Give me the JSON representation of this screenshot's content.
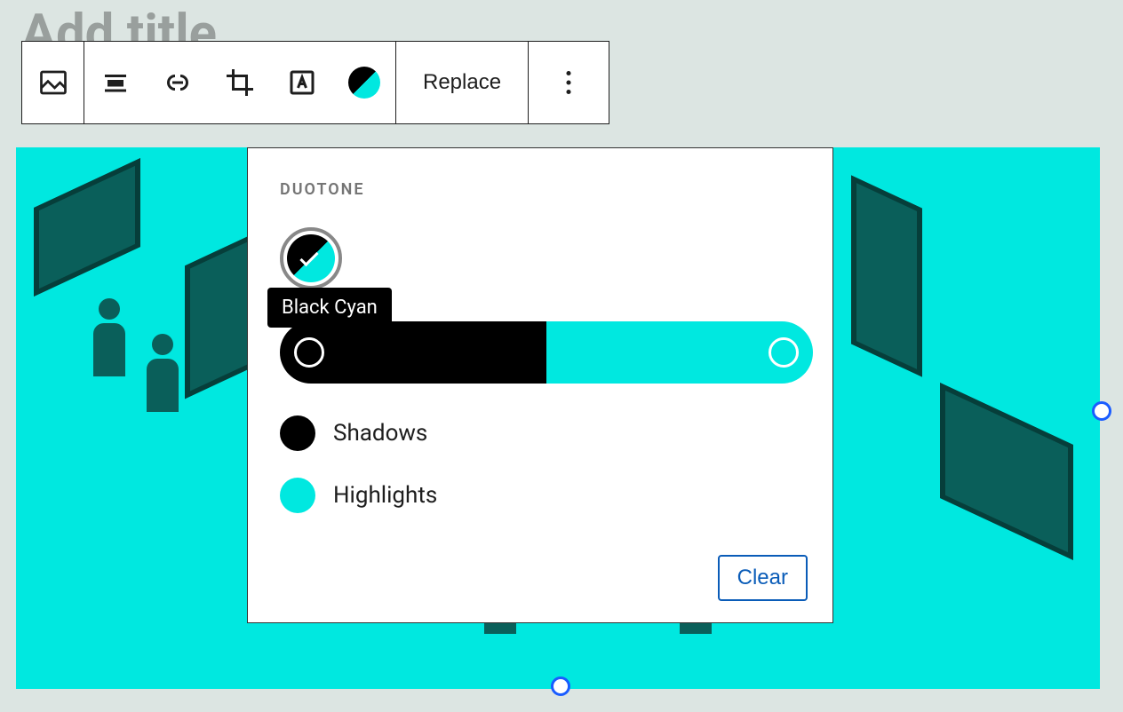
{
  "page": {
    "title_placeholder": "Add title"
  },
  "toolbar": {
    "replace_label": "Replace"
  },
  "duotone": {
    "heading": "DUOTONE",
    "selected_tooltip": "Black Cyan",
    "shadows_label": "Shadows",
    "highlights_label": "Highlights",
    "clear_label": "Clear",
    "shadow_color": "#000000",
    "highlight_color": "#00e8e0"
  }
}
